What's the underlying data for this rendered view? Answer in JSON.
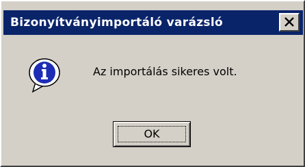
{
  "dialog": {
    "title": "Bizonyítványimportáló varázsló",
    "message": "Az importálás sikeres volt.",
    "ok_label": "OK",
    "close_icon": "close-icon",
    "status_icon": "info-icon"
  },
  "colors": {
    "titlebar": "#0a246a",
    "face": "#d4d0c8",
    "icon_blue": "#1d2db5"
  }
}
